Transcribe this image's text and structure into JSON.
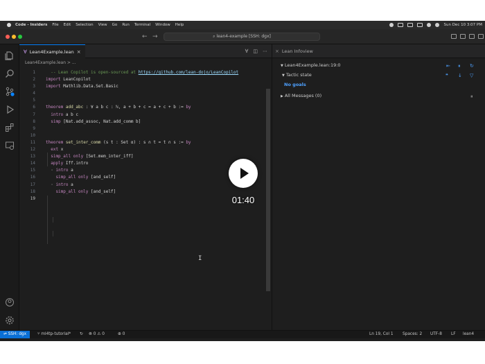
{
  "menubar": {
    "app": "Code - Insiders",
    "items": [
      "File",
      "Edit",
      "Selection",
      "View",
      "Go",
      "Run",
      "Terminal",
      "Window",
      "Help"
    ],
    "clock": "Sun Dec 10  3:07 PM"
  },
  "titlebar": {
    "command_center": "lean4-example [SSH: dgx]"
  },
  "editor": {
    "tab_label": "Lean4Example.lean",
    "breadcrumb": "Lean4Example.lean > ...",
    "lines": [
      {
        "n": "1",
        "segments": [
          {
            "t": "  -- Lean Copilot is open-sourced at ",
            "c": "c-com"
          },
          {
            "t": "https://github.com/lean-dojo/LeanCopilot",
            "c": "c-link"
          }
        ]
      },
      {
        "n": "2",
        "segments": [
          {
            "t": "import ",
            "c": "c-kw"
          },
          {
            "t": "LeanCopilot",
            "c": ""
          }
        ]
      },
      {
        "n": "3",
        "segments": [
          {
            "t": "import ",
            "c": "c-kw"
          },
          {
            "t": "Mathlib.Data.Set.Basic",
            "c": ""
          }
        ]
      },
      {
        "n": "4",
        "segments": []
      },
      {
        "n": "5",
        "segments": []
      },
      {
        "n": "6",
        "segments": [
          {
            "t": "theorem ",
            "c": "c-kw"
          },
          {
            "t": "add_abc",
            "c": "c-fn"
          },
          {
            "t": " : ∀ a b c : ℕ, a + b + c = a + c + b := ",
            "c": ""
          },
          {
            "t": "by",
            "c": "c-kw"
          }
        ]
      },
      {
        "n": "7",
        "segments": [
          {
            "t": "  intro ",
            "c": "c-kw"
          },
          {
            "t": "a b c",
            "c": ""
          }
        ]
      },
      {
        "n": "8",
        "segments": [
          {
            "t": "  simp ",
            "c": "c-kw"
          },
          {
            "t": "[Nat.add_assoc, Nat.add_comm b]",
            "c": ""
          }
        ]
      },
      {
        "n": "9",
        "segments": []
      },
      {
        "n": "10",
        "segments": []
      },
      {
        "n": "11",
        "segments": [
          {
            "t": "theorem ",
            "c": "c-kw"
          },
          {
            "t": "set_inter_comm",
            "c": "c-fn"
          },
          {
            "t": " (s t : Set α) : s ∩ t = t ∩ s := ",
            "c": ""
          },
          {
            "t": "by",
            "c": "c-kw"
          }
        ]
      },
      {
        "n": "12",
        "segments": [
          {
            "t": "  ext ",
            "c": "c-kw"
          },
          {
            "t": "x",
            "c": ""
          }
        ]
      },
      {
        "n": "13",
        "segments": [
          {
            "t": "  simp_all only ",
            "c": "c-kw"
          },
          {
            "t": "[Set.mem_inter_iff]",
            "c": ""
          }
        ]
      },
      {
        "n": "14",
        "segments": [
          {
            "t": "  apply ",
            "c": "c-kw"
          },
          {
            "t": "Iff.intro",
            "c": ""
          }
        ]
      },
      {
        "n": "15",
        "segments": [
          {
            "t": "  · ",
            "c": ""
          },
          {
            "t": "intro ",
            "c": "c-kw"
          },
          {
            "t": "a",
            "c": ""
          }
        ]
      },
      {
        "n": "16",
        "segments": [
          {
            "t": "    simp_all only ",
            "c": "c-kw"
          },
          {
            "t": "[and_self]",
            "c": ""
          }
        ]
      },
      {
        "n": "17",
        "segments": [
          {
            "t": "  · ",
            "c": ""
          },
          {
            "t": "intro ",
            "c": "c-kw"
          },
          {
            "t": "a",
            "c": ""
          }
        ]
      },
      {
        "n": "18",
        "segments": [
          {
            "t": "    simp_all only ",
            "c": "c-kw"
          },
          {
            "t": "[and_self]",
            "c": ""
          }
        ]
      },
      {
        "n": "19",
        "segments": []
      }
    ]
  },
  "infoview": {
    "tab_label": "Lean Infoview",
    "position": "Lean4Example.lean:19:0",
    "tactic_state": "Tactic state",
    "goals": "No goals",
    "messages": "All Messages (0)"
  },
  "video": {
    "timestamp": "01:40"
  },
  "statusbar": {
    "remote": "SSH: dgx",
    "branch": "ml4tp-tutorial*",
    "problems": "⊗ 0 ⚠ 0",
    "ports": "0",
    "position": "Ln 19, Col 1",
    "spaces": "Spaces: 2",
    "encoding": "UTF-8",
    "eol": "LF",
    "language": "lean4"
  }
}
